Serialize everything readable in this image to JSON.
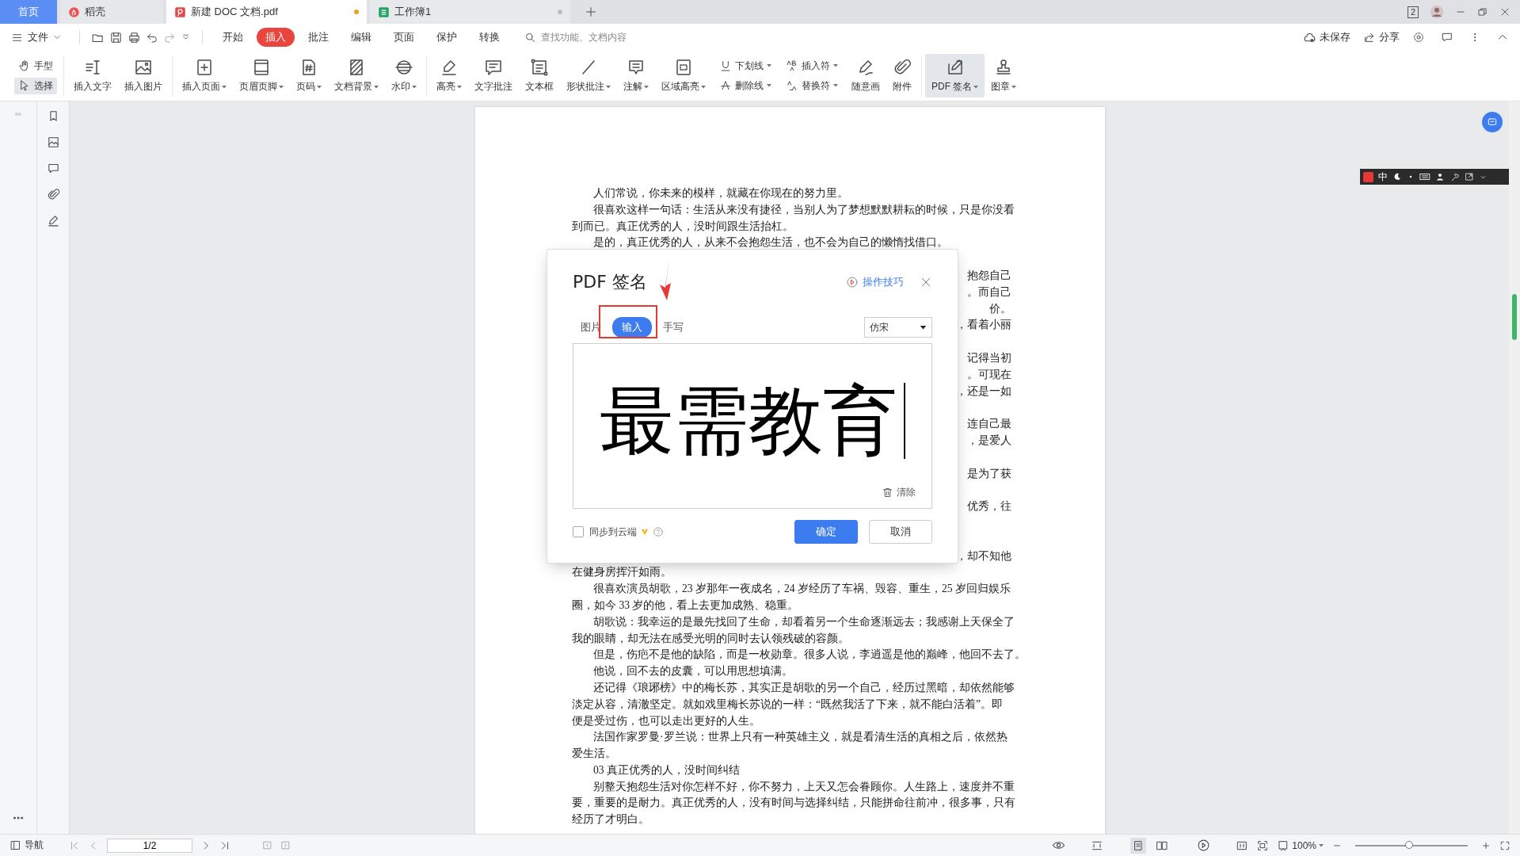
{
  "tabs": [
    {
      "label": "首页",
      "kind": "home",
      "selected": false
    },
    {
      "label": "稻壳",
      "kind": "docer",
      "selected": false
    },
    {
      "label": "新建 DOC 文档.pdf",
      "kind": "pdf",
      "selected": true,
      "modified": true
    },
    {
      "label": "工作簿1",
      "kind": "sheet",
      "selected": false,
      "modified": false
    }
  ],
  "window_badge": "2",
  "menu": {
    "file": "文件",
    "tabs": [
      {
        "label": "开始",
        "selected": false
      },
      {
        "label": "插入",
        "selected": true
      },
      {
        "label": "批注",
        "selected": false
      },
      {
        "label": "编辑",
        "selected": false
      },
      {
        "label": "页面",
        "selected": false
      },
      {
        "label": "保护",
        "selected": false
      },
      {
        "label": "转换",
        "selected": false
      }
    ],
    "search": {
      "placeholder": "查找功能、文档内容"
    },
    "unsaved": "未保存",
    "share": "分享"
  },
  "toolbar": {
    "groups": [
      [
        {
          "kind": "stack",
          "items": [
            {
              "label": "手型",
              "dropdown": false,
              "selected": false
            },
            {
              "label": "选择",
              "dropdown": false,
              "selected": true
            }
          ]
        }
      ],
      [
        {
          "kind": "large",
          "label": "插入文字",
          "dropdown": false,
          "selected": false
        },
        {
          "kind": "large",
          "label": "插入图片",
          "dropdown": false,
          "selected": false
        }
      ],
      [
        {
          "kind": "large",
          "label": "插入页面",
          "dropdown": true,
          "selected": false
        },
        {
          "kind": "large",
          "label": "页眉页脚",
          "dropdown": true,
          "selected": false
        },
        {
          "kind": "large",
          "label": "页码",
          "dropdown": true,
          "selected": false
        },
        {
          "kind": "large",
          "label": "文档背景",
          "dropdown": true,
          "selected": false
        },
        {
          "kind": "large",
          "label": "水印",
          "dropdown": true,
          "selected": false
        }
      ],
      [
        {
          "kind": "large",
          "label": "高亮",
          "dropdown": true,
          "selected": false
        },
        {
          "kind": "large",
          "label": "文字批注",
          "dropdown": false,
          "selected": false
        },
        {
          "kind": "large",
          "label": "文本框",
          "dropdown": false,
          "selected": false
        },
        {
          "kind": "large",
          "label": "形状批注",
          "dropdown": true,
          "selected": false
        },
        {
          "kind": "large",
          "label": "注解",
          "dropdown": true,
          "selected": false
        },
        {
          "kind": "large",
          "label": "区域高亮",
          "dropdown": true,
          "selected": false
        },
        {
          "kind": "stack",
          "items": [
            {
              "label": "下划线",
              "dropdown": true,
              "selected": false
            },
            {
              "label": "删除线",
              "dropdown": true,
              "selected": false
            }
          ]
        },
        {
          "kind": "stack",
          "items": [
            {
              "label": "插入符",
              "dropdown": true,
              "selected": false
            },
            {
              "label": "替换符",
              "dropdown": true,
              "selected": false
            }
          ]
        },
        {
          "kind": "large",
          "label": "随意画",
          "dropdown": false,
          "selected": false
        },
        {
          "kind": "large",
          "label": "附件",
          "dropdown": false,
          "selected": false
        }
      ],
      [
        {
          "kind": "large",
          "label": "PDF 签名",
          "dropdown": true,
          "selected": true
        },
        {
          "kind": "large",
          "label": "图章",
          "dropdown": true,
          "selected": false
        }
      ]
    ]
  },
  "ime_bar": {
    "mode": "中"
  },
  "document": {
    "lines_above": [
      {
        "text": "人们常说，你未来的模样，就藏在你现在的努力里。",
        "indent": true
      },
      {
        "text": "很喜欢这样一句话：生活从来没有捷径，当别人为了梦想默默耕耘的时候，只是你没看",
        "indent": true
      },
      {
        "text": "到而已。真正优秀的人，没时间跟生活抬杠。",
        "indent": false
      },
      {
        "text": "是的，真正优秀的人，从来不会抱怨生活，也不会为自己的懒惰找借口。",
        "indent": true
      }
    ],
    "covered_paragraphs": [
      [
        "抱怨自己",
        "。而自己",
        "价。",
        "，看着小丽"
      ],
      [
        "记得当初",
        "。可现在",
        "，还是一如"
      ],
      [
        "连自己最",
        "，是爱人"
      ],
      [
        "是为了获"
      ],
      [
        "优秀，往"
      ],
      [
        "，却不知他"
      ]
    ],
    "lines_below": [
      {
        "text": "在健身房挥汗如雨。",
        "indent": false
      },
      {
        "text": "很喜欢演员胡歌，23 岁那年一夜成名，24 岁经历了车祸、毁容、重生，25 岁回归娱乐",
        "indent": true
      },
      {
        "text": "圈，如今 33 岁的他，看上去更加成熟、稳重。",
        "indent": false
      },
      {
        "text": "胡歌说：我幸运的是最先找回了生命，却看着另一个生命逐渐远去；我感谢上天保全了",
        "indent": true
      },
      {
        "text": "我的眼睛，却无法在感受光明的同时去认领残破的容颜。",
        "indent": false
      },
      {
        "text": "但是，伤疤不是他的缺陷，而是一枚勋章。很多人说，李逍遥是他的巅峰，他回不去了。",
        "indent": true
      },
      {
        "text": "他说，回不去的皮囊，可以用思想填满。",
        "indent": true
      },
      {
        "text": "还记得《琅琊榜》中的梅长苏，其实正是胡歌的另一个自己，经历过黑暗，却依然能够",
        "indent": true
      },
      {
        "text": "淡定从容，清澈坚定。就如戏里梅长苏说的一样：“既然我活了下来，就不能白活着”。即",
        "indent": false
      },
      {
        "text": "便是受过伤，也可以走出更好的人生。",
        "indent": false
      },
      {
        "text": "法国作家罗曼·罗兰说：世界上只有一种英雄主义，就是看清生活的真相之后，依然热",
        "indent": true
      },
      {
        "text": "爱生活。",
        "indent": false
      },
      {
        "text": "03  真正优秀的人，没时间纠结",
        "indent": true
      },
      {
        "text": "别整天抱怨生活对你怎样不好，你不努力，上天又怎会眷顾你。人生路上，速度并不重",
        "indent": true
      },
      {
        "text": "要，重要的是耐力。真正优秀的人，没有时间与选择纠结，只能拼命往前冲，很多事，只有",
        "indent": false
      },
      {
        "text": "经历了才明白。",
        "indent": false
      }
    ]
  },
  "dialog": {
    "title": "PDF 签名",
    "tips": "操作技巧",
    "tabs": [
      {
        "label": "图片",
        "selected": false
      },
      {
        "label": "输入",
        "selected": true
      },
      {
        "label": "手写",
        "selected": false
      }
    ],
    "font": "仿宋",
    "signature": "最需教育",
    "clear": "清除",
    "sync": {
      "label": "同步到云端",
      "checked": false
    },
    "ok": "确定",
    "cancel": "取消"
  },
  "status_bar": {
    "nav": "导航",
    "page": "1/2",
    "page_views": [
      {
        "selected": true
      },
      {
        "selected": false
      }
    ],
    "zoom": "100%",
    "zoom_slider": {
      "level": 0.48
    }
  }
}
